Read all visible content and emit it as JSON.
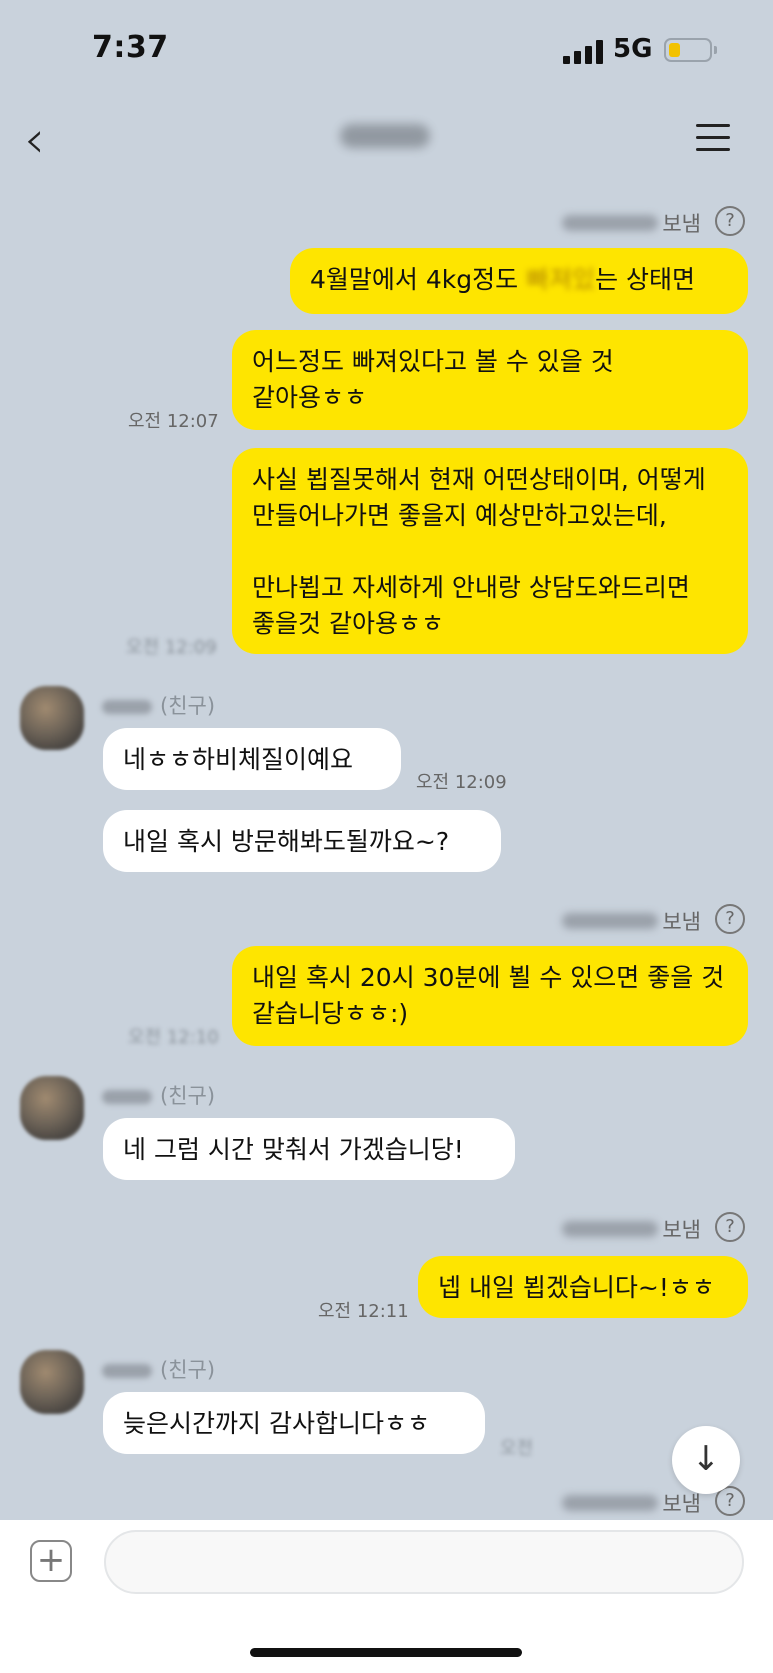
{
  "status_bar": {
    "time": "7:37",
    "network": "5G",
    "battery_level": 0.3
  },
  "header": {
    "back_icon": "chevron-left-icon",
    "menu_icon": "hamburger-menu-icon"
  },
  "messages": [
    {
      "sender": "me",
      "header_label": "보냄",
      "text_before": "4월말에서 4kg정도 ",
      "text_blurred": "빠져있",
      "text_after": "는 상태면"
    },
    {
      "sender": "me",
      "text": "어느정도 빠져있다고 볼 수 있을 것 같아용ㅎㅎ",
      "time": "오전 12:07"
    },
    {
      "sender": "me",
      "text": "사실 뵙질못해서 현재 어떤상태이며, 어떻게 만들어나가면 좋을지 예상만하고있는데,\n\n만나뵙고 자세하게 안내랑 상담도와드리면 좋을것 같아용ㅎㅎ",
      "time": "오전 12:09"
    },
    {
      "sender": "friend",
      "friend_tag": "(친구)",
      "text": "네ㅎㅎ하비체질이예요",
      "time": "오전 12:09"
    },
    {
      "sender": "friend",
      "text": "내일 혹시 방문해봐도될까요~?"
    },
    {
      "sender": "me",
      "header_label": "보냄",
      "text": "내일 혹시 20시 30분에 뵐 수 있으면 좋을 것 같습니당ㅎㅎ:)",
      "time": "오전 12:10"
    },
    {
      "sender": "friend",
      "friend_tag": "(친구)",
      "text": "네 그럼 시간 맞춰서 가겠습니당!"
    },
    {
      "sender": "me",
      "header_label": "보냄",
      "text": "넵 내일 뵙겠습니다~!ㅎㅎ",
      "time": "오전 12:11"
    },
    {
      "sender": "friend",
      "friend_tag": "(친구)",
      "text": "늦은시간까지 감사합니다ㅎㅎ",
      "time": "오전"
    },
    {
      "sender": "me",
      "header_label": "보냄"
    }
  ],
  "qmark": "?",
  "scroll_down_glyph": "↓",
  "input_bar": {
    "plus_glyph": "+",
    "placeholder": ""
  }
}
